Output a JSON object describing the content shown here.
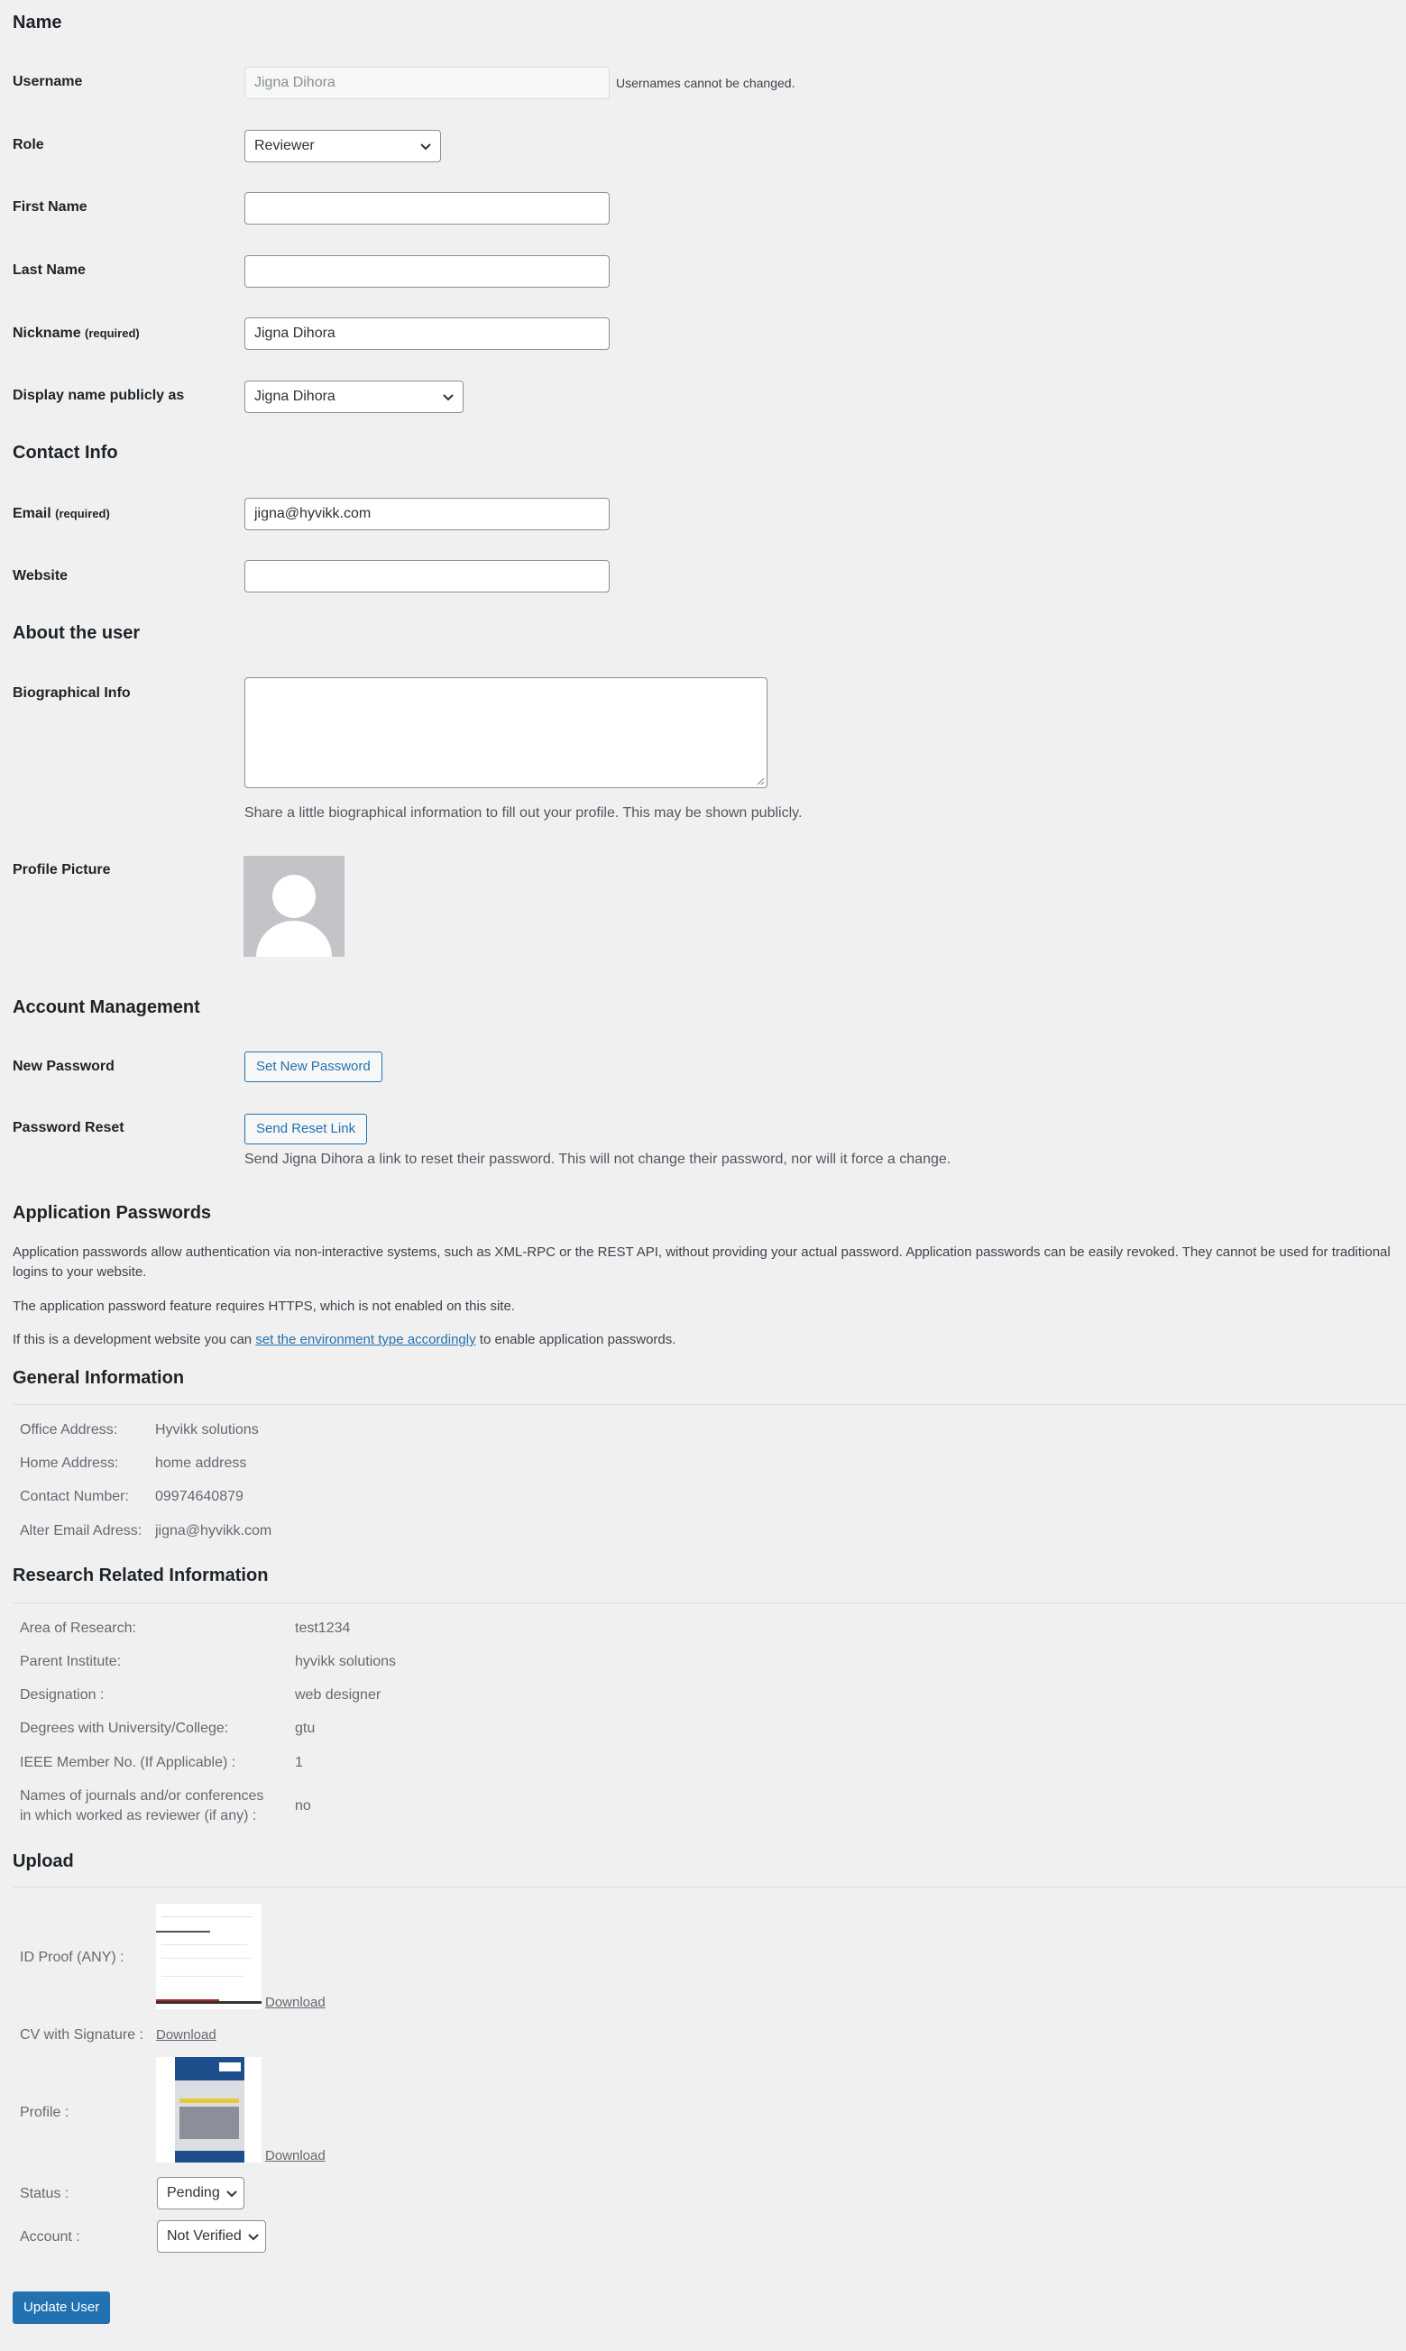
{
  "sections": {
    "name": "Name",
    "contact": "Contact Info",
    "about": "About the user",
    "account": "Account Management",
    "app_passwords": "Application Passwords",
    "general": "General Information",
    "research": "Research Related Information",
    "upload": "Upload"
  },
  "username": {
    "label": "Username",
    "value": "Jigna Dihora",
    "note": "Usernames cannot be changed."
  },
  "role": {
    "label": "Role",
    "value": "Reviewer"
  },
  "first_name": {
    "label": "First Name",
    "value": ""
  },
  "last_name": {
    "label": "Last Name",
    "value": ""
  },
  "nickname": {
    "label": "Nickname",
    "required": "(required)",
    "value": "Jigna Dihora"
  },
  "display_name": {
    "label": "Display name publicly as",
    "value": "Jigna Dihora"
  },
  "email": {
    "label": "Email",
    "required": "(required)",
    "value": "jigna@hyvikk.com"
  },
  "website": {
    "label": "Website",
    "value": ""
  },
  "bio": {
    "label": "Biographical Info",
    "value": "",
    "description": "Share a little biographical information to fill out your profile. This may be shown publicly."
  },
  "profile_picture": {
    "label": "Profile Picture"
  },
  "new_password": {
    "label": "New Password",
    "button": "Set New Password"
  },
  "password_reset": {
    "label": "Password Reset",
    "button": "Send Reset Link",
    "description": "Send Jigna Dihora a link to reset their password. This will not change their password, nor will it force a change."
  },
  "app_passwords": {
    "p1": "Application passwords allow authentication via non-interactive systems, such as XML-RPC or the REST API, without providing your actual password. Application passwords can be easily revoked. They cannot be used for traditional logins to your website.",
    "p2": "The application password feature requires HTTPS, which is not enabled on this site.",
    "p3_before": "If this is a development website you can ",
    "p3_link": "set the environment type accordingly",
    "p3_after": " to enable application passwords."
  },
  "general_info": [
    {
      "label": "Office Address:",
      "value": "Hyvikk solutions"
    },
    {
      "label": "Home Address:",
      "value": "home address"
    },
    {
      "label": "Contact Number:",
      "value": "09974640879"
    },
    {
      "label": "Alter Email Adress:",
      "value": "jigna@hyvikk.com"
    }
  ],
  "research_info": [
    {
      "label": "Area of Research:",
      "value": "test1234"
    },
    {
      "label": "Parent Institute:",
      "value": "hyvikk solutions"
    },
    {
      "label": "Designation :",
      "value": "web designer"
    },
    {
      "label": "Degrees with University/College:",
      "value": "gtu"
    },
    {
      "label": "IEEE Member No. (If Applicable) :",
      "value": "1"
    },
    {
      "label": "Names of journals and/or conferences",
      "label2": "in which worked as reviewer (if any) :",
      "value": "no"
    }
  ],
  "upload": {
    "id_proof": "ID Proof (ANY) :",
    "cv": "CV with Signature :",
    "profile": "Profile :",
    "download": "Download",
    "status_label": "Status :",
    "status_value": "Pending",
    "account_label": "Account :",
    "account_value": "Not Verified"
  },
  "submit": "Update User",
  "colors": {
    "accent": "#2271b1",
    "background": "#f0f0f1"
  }
}
